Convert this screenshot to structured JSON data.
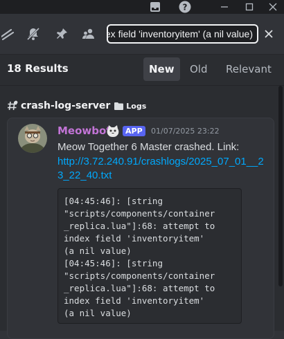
{
  "titlebar": {
    "inbox_icon": "inbox-icon",
    "help_icon": "question-circle-icon",
    "minimize": "minimize-icon",
    "maximize": "maximize-icon",
    "close": "close-icon"
  },
  "toolbar": {
    "icons": [
      "threads-icon",
      "bell-mute-icon",
      "pin-icon",
      "members-icon"
    ]
  },
  "search": {
    "value": "dex field 'inventoryitem' (a nil value)",
    "clear_icon": "close-icon"
  },
  "results": {
    "count_label": "18 Results",
    "tabs": [
      {
        "label": "New",
        "active": true
      },
      {
        "label": "Old",
        "active": false
      },
      {
        "label": "Relevant",
        "active": false
      }
    ]
  },
  "result": {
    "channel": "crash-log-server",
    "category": "Logs",
    "author": "Meowbot",
    "badge": "APP",
    "timestamp": "01/07/2025 23:22",
    "text": "Meow Together 6 Master crashed. Link:",
    "link": "http://3.72.240.91/crashlogs/2025_07_01__23_22_40.txt",
    "code": "[04:45:46]: [string\n\"scripts/components/container\n_replica.lua\"]:68: attempt to\nindex field 'inventoryitem'\n(a nil value)\n[04:45:46]: [string\n\"scripts/components/container\n_replica.lua\"]:68: attempt to\nindex field 'inventoryitem'\n(a nil value)"
  },
  "colors": {
    "accent": "#5865f2",
    "link": "#00a8fc",
    "author": "#c274d6"
  }
}
